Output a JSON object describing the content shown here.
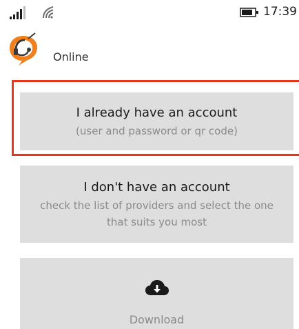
{
  "status_bar": {
    "time": "17:39",
    "icons": [
      "signal-icon",
      "wifi-icon",
      "battery-icon"
    ]
  },
  "header": {
    "status": "Online",
    "logo_icon": "headset-logo-icon"
  },
  "options": {
    "existing_account": {
      "title": "I already have an account",
      "subtitle": "(user and password or qr code)"
    },
    "new_account": {
      "title": "I don't have an account",
      "subtitle": "check the list of providers and select the one that suits you most"
    },
    "download": {
      "label": "Download",
      "icon": "cloud-download-icon"
    }
  },
  "colors": {
    "accent_logo": "#f07f1c",
    "selection": "#e8361c",
    "tile_bg": "#dedede"
  }
}
